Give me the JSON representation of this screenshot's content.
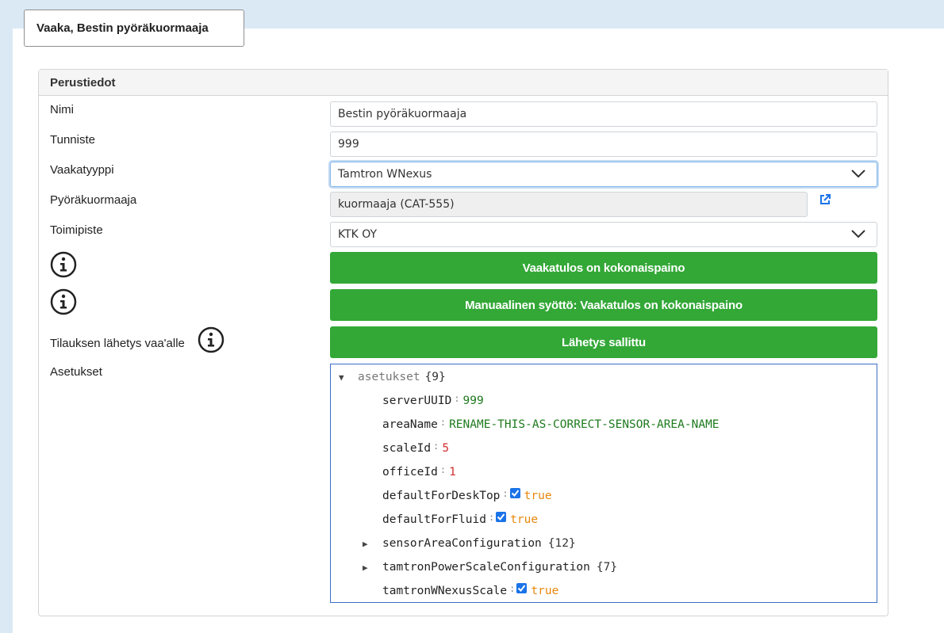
{
  "page_title": "Vaaka, Bestin pyöräkuormaaja",
  "card_header": "Perustiedot",
  "fields": {
    "nimi": {
      "label": "Nimi",
      "value": "Bestin pyöräkuormaaja"
    },
    "tunniste": {
      "label": "Tunniste",
      "value": "999"
    },
    "vaakatyyppi": {
      "label": "Vaakatyyppi",
      "value": "Tamtron WNexus"
    },
    "pyorakuormaaja": {
      "label": "Pyöräkuormaaja",
      "value": "kuormaaja (CAT-555)"
    },
    "toimipiste": {
      "label": "Toimipiste",
      "value": "KTK OY"
    }
  },
  "buttons": {
    "kokonaispaino": "Vaakatulos on kokonaispaino",
    "manuaalinen": "Manuaalinen syöttö: Vaakatulos on kokonaispaino",
    "lahetys": "Lähetys sallittu"
  },
  "tilauksen_label": "Tilauksen lähetys vaa'alle",
  "asetukset_label": "Asetukset",
  "json_tree": {
    "root_key": "asetukset",
    "root_count": "{9}",
    "rows": [
      {
        "key": "serverUUID",
        "value": "999",
        "type": "string"
      },
      {
        "key": "areaName",
        "value": "RENAME-THIS-AS-CORRECT-SENSOR-AREA-NAME",
        "type": "string"
      },
      {
        "key": "scaleId",
        "value": "5",
        "type": "number"
      },
      {
        "key": "officeId",
        "value": "1",
        "type": "number"
      },
      {
        "key": "defaultForDeskTop",
        "value": "true",
        "type": "boolean"
      },
      {
        "key": "defaultForFluid",
        "value": "true",
        "type": "boolean"
      },
      {
        "key": "sensorAreaConfiguration",
        "count": "{12}",
        "type": "object"
      },
      {
        "key": "tamtronPowerScaleConfiguration",
        "count": "{7}",
        "type": "object"
      },
      {
        "key": "tamtronWNexusScale",
        "value": "true",
        "type": "boolean"
      }
    ]
  },
  "colors": {
    "button_green": "#33a837",
    "string_value": "#1e7a1e",
    "number_value": "#d32f2f",
    "boolean_value": "#e8870c"
  },
  "icons": [
    "info-icon",
    "external-link-icon",
    "chevron-down-icon",
    "checkbox-icon",
    "expand-arrow-icon"
  ]
}
